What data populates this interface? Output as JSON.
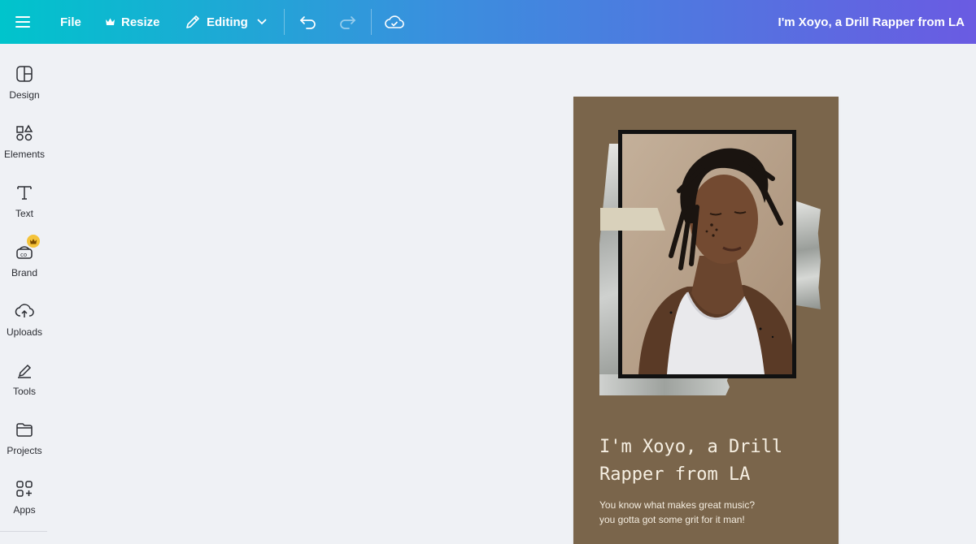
{
  "topbar": {
    "file_label": "File",
    "resize_label": "Resize",
    "editing_label": "Editing",
    "document_title": "I'm Xoyo, a Drill Rapper from LA"
  },
  "sidebar": {
    "items": [
      {
        "label": "Design",
        "icon": "design-icon"
      },
      {
        "label": "Elements",
        "icon": "elements-icon"
      },
      {
        "label": "Text",
        "icon": "text-icon"
      },
      {
        "label": "Brand",
        "icon": "brand-icon",
        "badge": "crown-icon"
      },
      {
        "label": "Uploads",
        "icon": "uploads-icon"
      },
      {
        "label": "Tools",
        "icon": "tools-icon"
      },
      {
        "label": "Projects",
        "icon": "projects-icon"
      },
      {
        "label": "Apps",
        "icon": "apps-icon"
      }
    ]
  },
  "poster": {
    "title_line1": "I'm Xoyo, a Drill",
    "title_line2": "Rapper from LA",
    "subtitle_line1": "You know what makes great music?",
    "subtitle_line2": "you gotta got some grit for it man!",
    "background_color": "#7a654b"
  },
  "colors": {
    "gradient_start": "#00c4cc",
    "gradient_end": "#6a5be2",
    "canvas_bg": "#eff1f5"
  }
}
